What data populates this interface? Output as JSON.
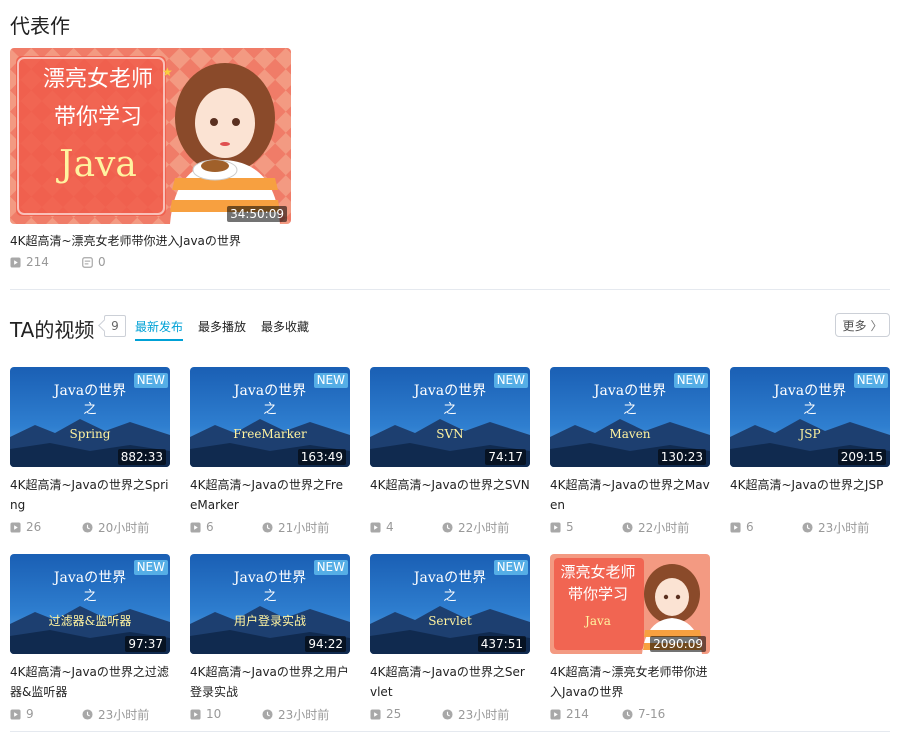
{
  "featured_section": {
    "title": "代表作",
    "video": {
      "thumb_text": [
        "漂亮女老师",
        "带你学习",
        "Java"
      ],
      "duration": "34:50:09",
      "title": "4K超高清~漂亮女老师带你进入Javaの世界",
      "plays": "214",
      "danmaku": "0"
    }
  },
  "videos_section": {
    "title": "TA的视频",
    "count": "9",
    "tabs": [
      {
        "label": "最新发布",
        "active": true
      },
      {
        "label": "最多播放",
        "active": false
      },
      {
        "label": "最多收藏",
        "active": false
      }
    ],
    "more_label": "更多",
    "new_label": "NEW",
    "videos": [
      {
        "thumb_top": "Javaの世界",
        "thumb_mid": "之",
        "thumb_main": "Spring",
        "duration": "882:33",
        "title": "4K超高清~Javaの世界之Spring",
        "plays": "26",
        "time": "20小时前",
        "is_new": true
      },
      {
        "thumb_top": "Javaの世界",
        "thumb_mid": "之",
        "thumb_main": "FreeMarker",
        "duration": "163:49",
        "title": "4K超高清~Javaの世界之FreeMarker",
        "plays": "6",
        "time": "21小时前",
        "is_new": true
      },
      {
        "thumb_top": "Javaの世界",
        "thumb_mid": "之",
        "thumb_main": "SVN",
        "duration": "74:17",
        "title": "4K超高清~Javaの世界之SVN",
        "plays": "4",
        "time": "22小时前",
        "is_new": true
      },
      {
        "thumb_top": "Javaの世界",
        "thumb_mid": "之",
        "thumb_main": "Maven",
        "duration": "130:23",
        "title": "4K超高清~Javaの世界之Maven",
        "plays": "5",
        "time": "22小时前",
        "is_new": true
      },
      {
        "thumb_top": "Javaの世界",
        "thumb_mid": "之",
        "thumb_main": "JSP",
        "duration": "209:15",
        "title": "4K超高清~Javaの世界之JSP",
        "plays": "6",
        "time": "23小时前",
        "is_new": true
      },
      {
        "thumb_top": "Javaの世界",
        "thumb_mid": "之",
        "thumb_main": "过滤器&监听器",
        "duration": "97:37",
        "title": "4K超高清~Javaの世界之过滤器&监听器",
        "plays": "9",
        "time": "23小时前",
        "is_new": true
      },
      {
        "thumb_top": "Javaの世界",
        "thumb_mid": "之",
        "thumb_main": "用户登录实战",
        "duration": "94:22",
        "title": "4K超高清~Javaの世界之用户登录实战",
        "plays": "10",
        "time": "23小时前",
        "is_new": true
      },
      {
        "thumb_top": "Javaの世界",
        "thumb_mid": "之",
        "thumb_main": "Servlet",
        "duration": "437:51",
        "title": "4K超高清~Javaの世界之Servlet",
        "plays": "25",
        "time": "23小时前",
        "is_new": true
      },
      {
        "thumb_top": "漂亮女老师",
        "thumb_mid": "带你学习",
        "thumb_main": "Java",
        "duration": "2090:09",
        "title": "4K超高清~漂亮女老师带你进入Javaの世界",
        "plays": "214",
        "time": "7-16",
        "is_new": false
      }
    ]
  },
  "colors": {
    "accent": "#00a1d6",
    "new_badge": "#55aee6",
    "meta_text": "#999999",
    "thumb_blue": "#1f6fc0",
    "thumb_pink": "#f08a70",
    "thumb_yellow_text": "#fff3a0"
  },
  "icons": {
    "play": "play-count-icon",
    "danmaku": "danmaku-icon",
    "clock": "clock-icon",
    "chevron": "chevron-right-icon"
  }
}
